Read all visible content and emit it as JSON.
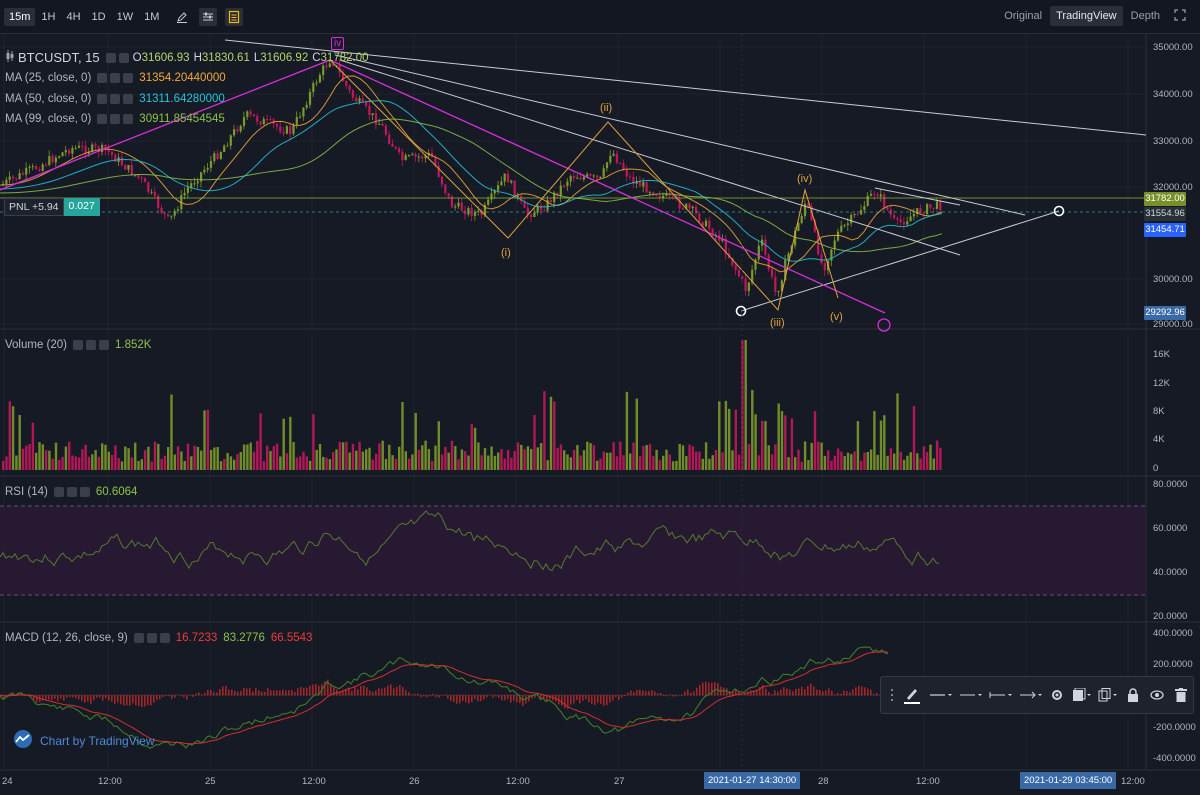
{
  "toolbar": {
    "timeframes": [
      "15m",
      "1H",
      "4H",
      "1D",
      "1W",
      "1M"
    ],
    "active_timeframe": "15m",
    "view_tabs": [
      "Original",
      "TradingView",
      "Depth"
    ],
    "active_view": "TradingView"
  },
  "main_legend": {
    "symbol": "BTCUSDT, 15",
    "open_label": "O",
    "open": "31606.93",
    "high_label": "H",
    "high": "31830.61",
    "low_label": "L",
    "low": "31606.92",
    "close_label": "C",
    "close": "31782.00"
  },
  "ma_rows": [
    {
      "label": "MA (25, close, 0)",
      "value": "31354.20440000",
      "color": "#f2a93b"
    },
    {
      "label": "MA (50, close, 0)",
      "value": "31311.64280000",
      "color": "#26c6da"
    },
    {
      "label": "MA (99, close, 0)",
      "value": "30911.85454545",
      "color": "#8bc34a"
    }
  ],
  "pnl": {
    "label": "PNL +5.94",
    "value": "0.027"
  },
  "price_axis": {
    "labels": [
      "35000.00",
      "34000.00",
      "33000.00",
      "32000.00",
      "30000.00",
      "29000.00"
    ],
    "tag_last": "31782.00",
    "tag_mid": "31554.96",
    "tag_blue": "31454.71",
    "tag_low": "29292.96"
  },
  "wave_labels": {
    "top_iv": "iv",
    "i": "(i)",
    "ii": "(ii)",
    "iii": "(iii)",
    "iv": "(iv)",
    "v": "(v)"
  },
  "volume": {
    "legend": "Volume (20)",
    "value": "1.852K",
    "axis": [
      "16K",
      "12K",
      "8K",
      "4K",
      "0"
    ]
  },
  "rsi": {
    "legend": "RSI (14)",
    "value": "60.6064",
    "axis": [
      "80.0000",
      "60.0000",
      "40.0000",
      "20.0000"
    ]
  },
  "macd": {
    "legend": "MACD (12, 26, close, 9)",
    "v1": "16.7233",
    "v2": "83.2776",
    "v3": "66.5543",
    "axis": [
      "400.0000",
      "200.0000",
      "-200.0000",
      "-400.0000"
    ]
  },
  "time_axis": {
    "labels": [
      "24",
      "12:00",
      "25",
      "12:00",
      "26",
      "12:00",
      "27",
      "28",
      "12:00",
      "12:00"
    ],
    "cursor_tag": "2021-01-27 14:30:00",
    "end_tag": "2021-01-29 03:45:00"
  },
  "brand": "Chart by TradingView",
  "colors": {
    "up": "#7a9a2a",
    "down": "#c2185b",
    "purple_wave": "#d62fd9",
    "orange_wave": "#e0a23c"
  }
}
